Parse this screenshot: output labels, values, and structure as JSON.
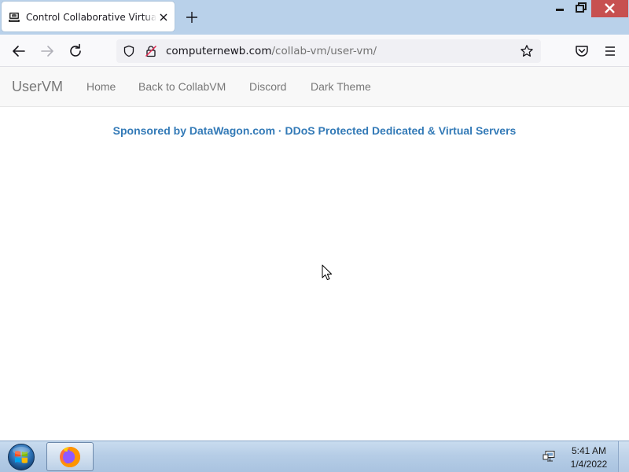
{
  "browser": {
    "tab": {
      "title": "Control Collaborative Virtual Machine"
    },
    "url": {
      "host": "computernewb.com",
      "path": "/collab-vm/user-vm/"
    }
  },
  "site": {
    "brand": "UserVM",
    "nav_links": [
      "Home",
      "Back to CollabVM",
      "Discord",
      "Dark Theme"
    ],
    "sponsor_text": "Sponsored by DataWagon.com · DDoS Protected Dedicated & Virtual Servers"
  },
  "taskbar": {
    "clock_time": "5:41 AM",
    "clock_date": "1/4/2022"
  },
  "colors": {
    "titlebar": "#b9d1ea",
    "link_blue": "#337ab7",
    "nav_text": "#777777",
    "close_red": "#c75050"
  },
  "icons": {
    "tab_favicon": "vm-favicon-icon",
    "tab_close": "close-icon",
    "new_tab": "plus-icon",
    "back": "back-arrow-icon",
    "forward": "forward-arrow-icon",
    "reload": "reload-icon",
    "tracking_protection": "shield-icon",
    "permissions": "lock-icon",
    "bookmark": "star-icon",
    "pocket": "pocket-icon",
    "menu": "hamburger-menu-icon",
    "start": "windows-start-orb-icon",
    "taskbar_app": "firefox-icon",
    "tray": "network-icon"
  }
}
